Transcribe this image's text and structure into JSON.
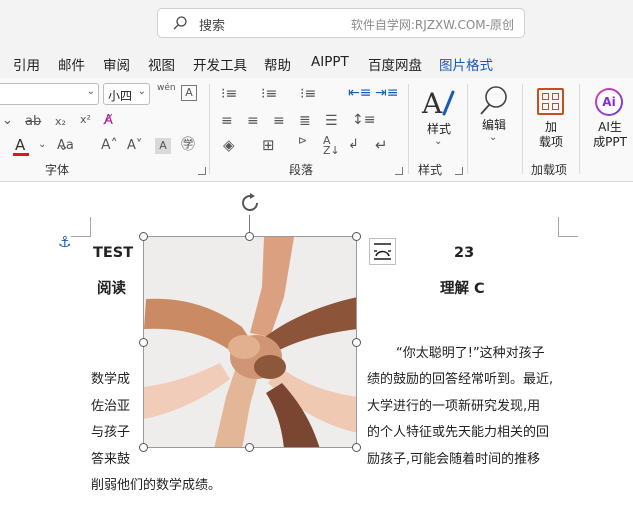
{
  "search": {
    "label": "搜索",
    "watermark": "软件自学网:RJZXW.COM-原创"
  },
  "tabs": [
    {
      "label": "引用"
    },
    {
      "label": "邮件"
    },
    {
      "label": "审阅"
    },
    {
      "label": "视图"
    },
    {
      "label": "开发工具"
    },
    {
      "label": "帮助"
    },
    {
      "label": "AIPPT"
    },
    {
      "label": "百度网盘"
    },
    {
      "label": "图片格式"
    }
  ],
  "ribbon": {
    "font_size_value": "小四",
    "wen_label": "wén",
    "groups": {
      "font": "字体",
      "paragraph": "段落",
      "styles": "样式",
      "addins": "加载项"
    },
    "style_button": "样式",
    "edit_button": "编辑",
    "addin_button_line1": "加",
    "addin_button_line2": "载项",
    "ai_button_line1": "AI生",
    "ai_button_line2": "成PPT",
    "ai_icon_text": "Ai"
  },
  "document": {
    "left_heading_1": "TEST",
    "left_heading_2": "阅读",
    "right_heading_1": "23",
    "right_heading_2": "理解 C",
    "right_lines": [
      "“你太聪明了!”这种对孩子",
      "绩的鼓励的回答经常听到。最近,",
      "大学进行的一项新研究发现,用",
      "的个人特征或先天能力相关的回",
      "励孩子,可能会随着时间的推移"
    ],
    "left_lines": [
      "数学成",
      "佐治亚",
      "与孩子",
      "答来鼓"
    ],
    "last_line": "削弱他们的数学成绩。"
  },
  "colors": {
    "accent_green": "#1f6f3a",
    "picture_format_blue": "#185abd",
    "font_color_red": "#e81123"
  }
}
